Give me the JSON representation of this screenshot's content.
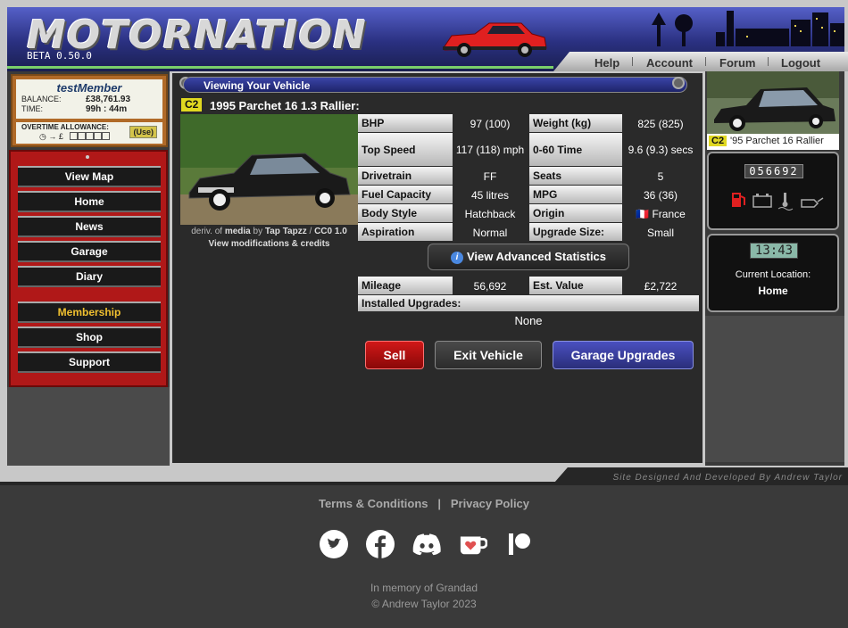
{
  "header": {
    "logo": "MOTORNATION",
    "version": "BETA 0.50.0",
    "nav": [
      "Help",
      "Account",
      "Forum",
      "Logout"
    ]
  },
  "member": {
    "name": "testMember",
    "balance_label": "BALANCE:",
    "balance": "£38,761.93",
    "time_label": "TIME:",
    "time": "99h : 44m",
    "overtime_label": "OVERTIME ALLOWANCE:",
    "overtime_icons": "◷ → £",
    "use_label": "(Use)"
  },
  "menu": {
    "items": [
      "View Map",
      "Home",
      "News",
      "Garage",
      "Diary"
    ],
    "items2": [
      "Membership",
      "Shop",
      "Support"
    ]
  },
  "main": {
    "title": "Viewing Your Vehicle",
    "vehicle_class": "C2",
    "vehicle_name": "1995 Parchet 16 1.3 Rallier:",
    "credit_prefix": "deriv. of",
    "credit_media": "media",
    "credit_by": "by",
    "credit_author": "Tap Tapzz",
    "credit_license": "CC0 1.0",
    "view_mods": "View modifications & credits",
    "stats": [
      {
        "l1": "BHP",
        "v1": "97 (100)",
        "l2": "Weight (kg)",
        "v2": "825 (825)"
      },
      {
        "l1": "Top Speed",
        "v1": "117 (118) mph",
        "l2": "0-60 Time",
        "v2": "9.6 (9.3) secs"
      },
      {
        "l1": "Drivetrain",
        "v1": "FF",
        "l2": "Seats",
        "v2": "5"
      },
      {
        "l1": "Fuel Capacity",
        "v1": "45 litres",
        "l2": "MPG",
        "v2": "36 (36)"
      },
      {
        "l1": "Body Style",
        "v1": "Hatchback",
        "l2": "Origin",
        "v2": "🇫🇷 France"
      },
      {
        "l1": "Aspiration",
        "v1": "Normal",
        "l2": "Upgrade Size:",
        "v2": "Small"
      }
    ],
    "advanced_button": "View Advanced Statistics",
    "stats2": [
      {
        "l1": "Mileage",
        "v1": "56,692",
        "l2": "Est. Value",
        "v2": "£2,722"
      }
    ],
    "installed_label": "Installed Upgrades:",
    "installed_value": "None",
    "sell": "Sell",
    "exit": "Exit Vehicle",
    "upgrades": "Garage Upgrades"
  },
  "right": {
    "car_class": "C2",
    "car_name": "'95 Parchet 16 Rallier",
    "odometer": "056692",
    "clock": "13:43",
    "location_label": "Current Location:",
    "location": "Home"
  },
  "footer": {
    "designed": "Site Designed And Developed By Andrew Taylor",
    "terms": "Terms & Conditions",
    "sep": "|",
    "privacy": "Privacy Policy",
    "social": [
      "twitter-icon",
      "facebook-icon",
      "discord-icon",
      "kofi-icon",
      "patreon-icon"
    ],
    "memory": "In memory of Grandad",
    "copyright": "© Andrew Taylor 2023"
  },
  "colors": {
    "accent_blue": "#2a3080",
    "menu_red": "#b01818",
    "class_yellow": "#e0d820",
    "green_line": "#7ad06a"
  }
}
